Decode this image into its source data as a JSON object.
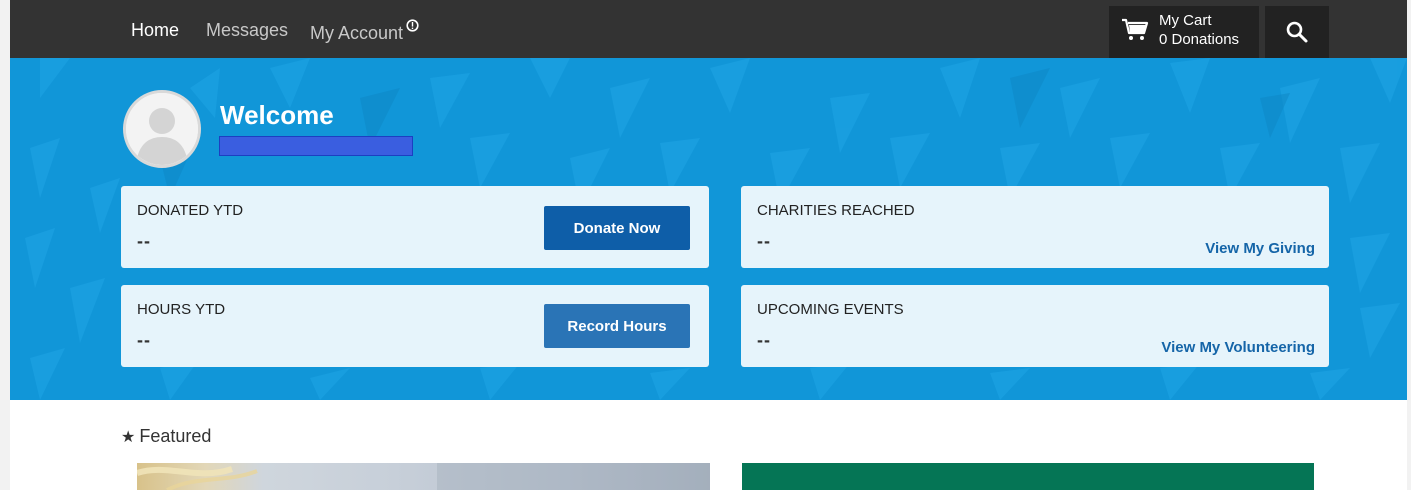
{
  "nav": {
    "items": [
      {
        "label": "Home",
        "active": true
      },
      {
        "label": "Messages",
        "active": false
      },
      {
        "label": "My Account",
        "active": false
      }
    ],
    "account_alert": "⓪",
    "cart": {
      "label": "My Cart",
      "count": "0 Donations",
      "icon": "cart-icon"
    },
    "search_icon": "search-icon"
  },
  "hero": {
    "welcome": "Welcome",
    "user_name_redacted": true,
    "cards": [
      {
        "title": "DONATED YTD",
        "value": "--",
        "action": "Donate Now"
      },
      {
        "title": "CHARITIES REACHED",
        "value": "--",
        "link": "View My Giving"
      },
      {
        "title": "HOURS YTD",
        "value": "--",
        "action": "Record Hours"
      },
      {
        "title": "UPCOMING EVENTS",
        "value": "--",
        "link": "View My Volunteering"
      }
    ]
  },
  "featured": {
    "label": "Featured",
    "icon": "star-icon"
  },
  "colors": {
    "nav_bg": "#333333",
    "hero_bg": "#1196d8",
    "card_bg": "#e6f4fb",
    "button_bg": "#0e5ea8",
    "link": "#1565a8",
    "featured_green": "#057555"
  }
}
